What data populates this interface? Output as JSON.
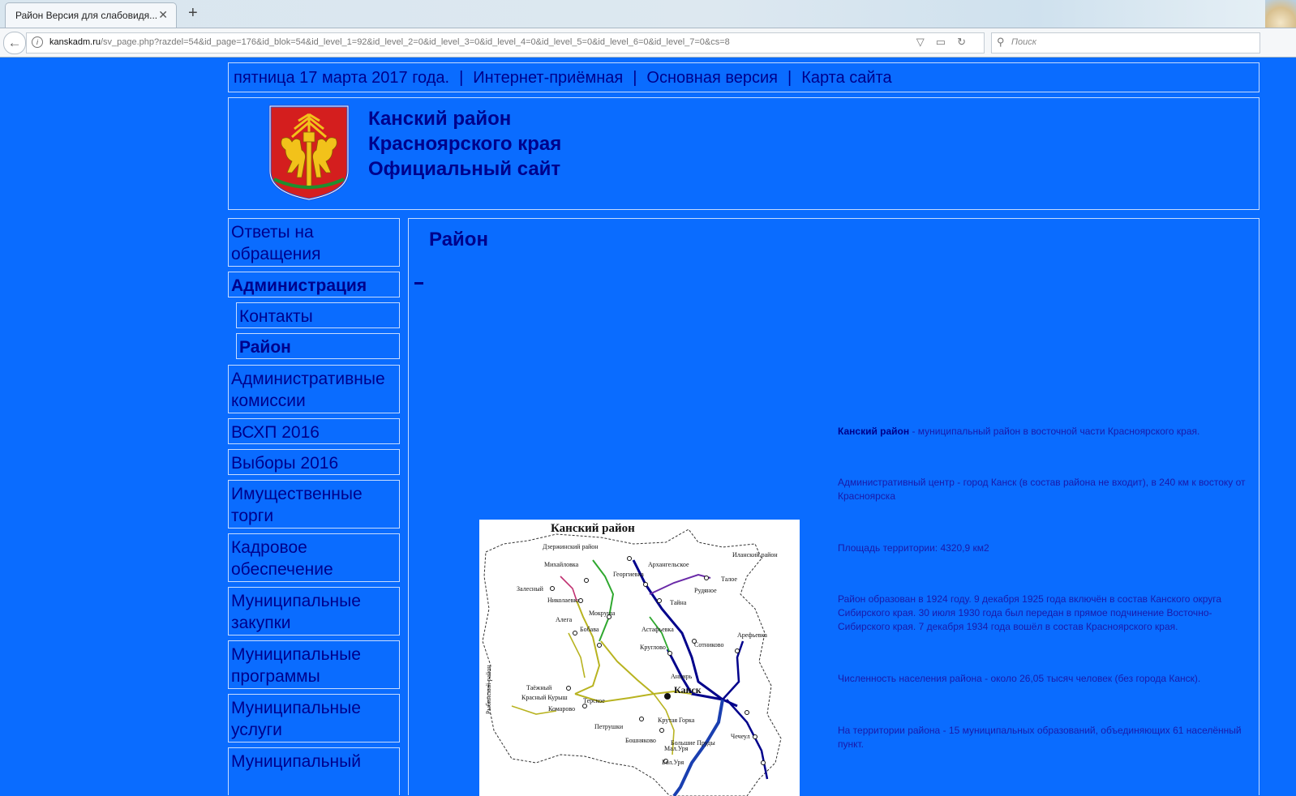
{
  "browser": {
    "tab_title": "Район Версия для слабовидя...",
    "url_host": "kanskadm.ru",
    "url_path": "/sv_page.php?razdel=54&id_page=176&id_blok=54&id_level_1=92&id_level_2=0&id_level_3=0&id_level_4=0&id_level_5=0&id_level_6=0&id_level_7=0&cs=8",
    "search_placeholder": "Поиск"
  },
  "topbar": {
    "date": "пятница 17 марта 2017 года.",
    "sep": "|",
    "links": [
      "Интернет-приёмная",
      "Основная версия",
      "Карта сайта"
    ]
  },
  "header": {
    "title_lines": [
      "Канский район",
      "Красноярского края",
      "Официальный сайт"
    ]
  },
  "sidebar": {
    "items": [
      {
        "label": "Ответы на обращения"
      },
      {
        "label": "Администрация"
      },
      {
        "label": "Контакты"
      },
      {
        "label": "Район"
      },
      {
        "label": "Административные комиссии"
      },
      {
        "label": "ВСХП 2016"
      },
      {
        "label": "Выборы 2016"
      },
      {
        "label": "Имущественные торги"
      },
      {
        "label": "Кадровое обеспечение"
      },
      {
        "label": "Муниципальные закупки"
      },
      {
        "label": "Муниципальные программы"
      },
      {
        "label": "Муниципальные услуги"
      },
      {
        "label": "Муниципальный"
      }
    ]
  },
  "content": {
    "title": "Район",
    "map": {
      "title": "Канский   район",
      "labels": [
        "Дзержинский район",
        "Иланский район",
        "Рыбинский район",
        "Канск",
        "Архангельское",
        "Тайна",
        "Рудяное",
        "Георгиевка",
        "Михайловка",
        "Николаевка",
        "Алега",
        "Бобава",
        "Мокруша",
        "Астафьевка",
        "Сотниково",
        "Арефьевка",
        "Круглово",
        "Таёжный",
        "Красный Курыш",
        "Комарово",
        "Терское",
        "Петрушки",
        "Бошняково",
        "Мал.Уря",
        "Бол.Уря",
        "Крутая Горка",
        "Чечеул",
        "Анцирь",
        "Залесный",
        "Талое",
        "Большие Пруды"
      ]
    },
    "paragraphs": [
      {
        "bold": "Канский район",
        "text": " - муниципальный район в восточной части Красноярского края."
      },
      {
        "bold": "",
        "text": "Административный центр - город Канск (в состав района не входит), в 240 км к востоку от Красноярска"
      },
      {
        "bold": "",
        "text": "Площадь территории: 4320,9 км2"
      },
      {
        "bold": "",
        "text": "Район образован в 1924 году. 9 декабря 1925 года включён в состав Канского округа Сибирского края. 30 июля 1930 года был передан в прямое подчинение Восточно-Сибирского края. 7 декабря 1934 года вошёл в состав Красноярского края."
      },
      {
        "bold": "",
        "text": "Численность населения района - около 26,05 тысяч человек (без города Канск)."
      },
      {
        "bold": "",
        "text": "На территории района - 15 муниципальных образований, объединяющих 61 населённый пункт."
      }
    ]
  },
  "colors": {
    "page_bg": "#0a6cff",
    "text_dark": "#00008b",
    "border": "#c7dcff"
  }
}
